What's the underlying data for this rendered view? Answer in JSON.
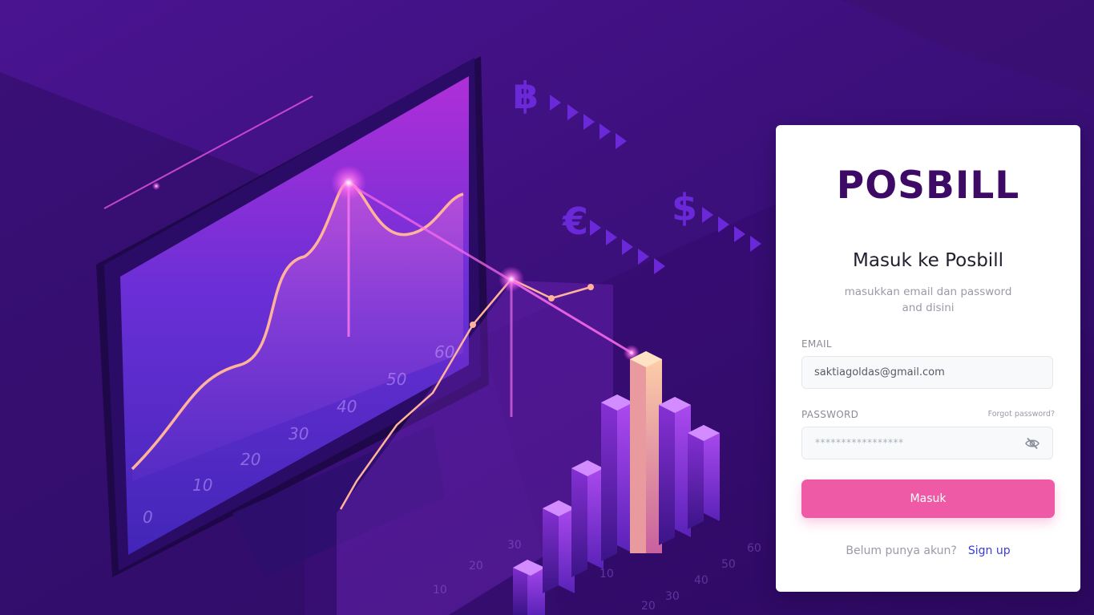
{
  "brand": {
    "logo": "POSBILL",
    "logo_color": "#3d0a66"
  },
  "login": {
    "title": "Masuk ke Posbill",
    "subtitle": "masukkan email dan password and disini",
    "email": {
      "label": "EMAIL",
      "value": "saktiagoldas@gmail.com"
    },
    "password": {
      "label": "PASSWORD",
      "masked_value": "*****************",
      "forgot_label": "Forgot password?",
      "visibility_icon": "eye-off-icon"
    },
    "submit_label": "Masuk",
    "signup_prompt": "Belum punya akun?",
    "signup_link": "Sign up"
  },
  "illustration": {
    "monitor_axis_labels": [
      "0",
      "10",
      "20",
      "30",
      "40",
      "50",
      "60"
    ],
    "floor_axis_labels": [
      "10",
      "20",
      "30",
      "10",
      "20",
      "30",
      "40",
      "50",
      "60"
    ],
    "currency_symbols": [
      "฿",
      "€",
      "$"
    ]
  },
  "colors": {
    "background": "#3a0f73",
    "accent": "#ee5aa5",
    "link": "#3b3bdb"
  }
}
